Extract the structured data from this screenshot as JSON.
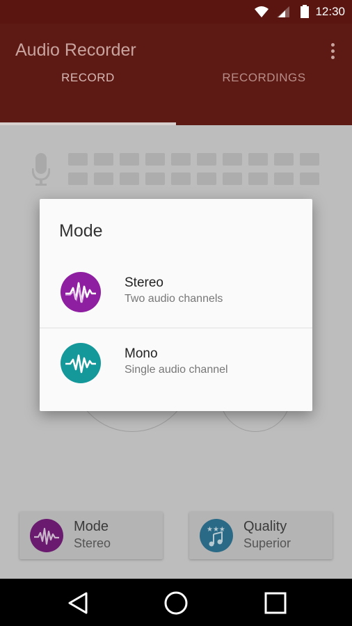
{
  "status_bar": {
    "time": "12:30"
  },
  "app_bar": {
    "title": "Audio Recorder"
  },
  "tabs": [
    {
      "label": "RECORD",
      "active": true
    },
    {
      "label": "RECORDINGS",
      "active": false
    }
  ],
  "bottom_cards": {
    "mode": {
      "title": "Mode",
      "value": "Stereo",
      "color": "#6a1b70"
    },
    "quality": {
      "title": "Quality",
      "value": "Superior",
      "color": "#2a6a86"
    }
  },
  "dialog": {
    "title": "Mode",
    "options": [
      {
        "label": "Stereo",
        "description": "Two audio channels",
        "icon": "waveform-icon",
        "color": "#8e1fa0"
      },
      {
        "label": "Mono",
        "description": "Single audio channel",
        "icon": "waveform-icon",
        "color": "#15989a"
      }
    ]
  },
  "colors": {
    "primary": "#5d1a14",
    "status_bar": "#5a1510"
  }
}
